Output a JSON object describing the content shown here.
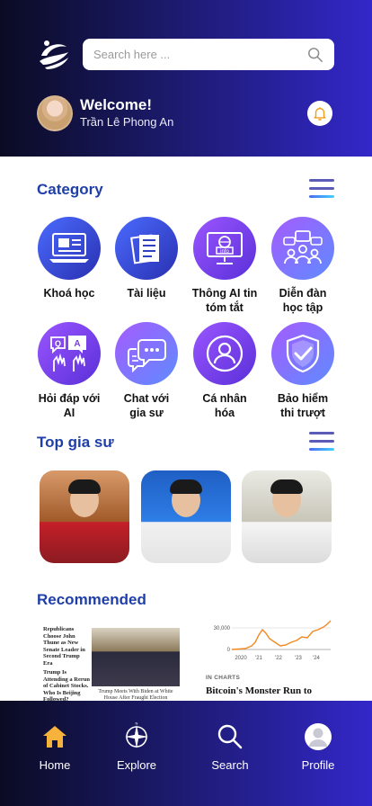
{
  "header": {
    "search_placeholder": "Search here ...",
    "welcome": "Welcome!",
    "user_name": "Trần Lê Phong An"
  },
  "category": {
    "title": "Category",
    "items": [
      {
        "label_line1": "Khoá học",
        "label_line2": "",
        "icon": "course-monitor-icon"
      },
      {
        "label_line1": "Tài liệu",
        "label_line2": "",
        "icon": "documents-icon"
      },
      {
        "label_line1": "Thông AI tin",
        "label_line2": "tóm tắt",
        "icon": "info-monitor-icon"
      },
      {
        "label_line1": "Diễn đàn",
        "label_line2": "học tập",
        "icon": "forum-group-icon"
      },
      {
        "label_line1": "Hỏi đáp với",
        "label_line2": "AI",
        "icon": "qa-bubbles-icon"
      },
      {
        "label_line1": "Chat với",
        "label_line2": "gia sư",
        "icon": "chat-icon"
      },
      {
        "label_line1": "Cá nhân",
        "label_line2": "hóa",
        "icon": "person-icon"
      },
      {
        "label_line1": "Bảo hiểm",
        "label_line2": "thi trượt",
        "icon": "shield-check-icon"
      }
    ]
  },
  "top_tutors": {
    "title": "Top gia sư"
  },
  "recommended": {
    "title": "Recommended",
    "card1": {
      "headline": "Republicans Choose John Thune as New Senate Leader in Second Trump Era",
      "headline2": "Trump Is Attending a Rerun of Cabinet Stocks. Who Is Beijing Followed?",
      "caption": "Trump Meets With Biden at White House After Fraught Election"
    },
    "card2": {
      "y_tick_top": "30,000",
      "y_tick_bottom": "0",
      "x_ticks": [
        "2020",
        "'21",
        "'22",
        "'23",
        "'24"
      ],
      "section": "IN CHARTS",
      "headline": "Bitcoin's Monster Run to"
    }
  },
  "nav": {
    "home": "Home",
    "explore": "Explore",
    "search": "Search",
    "profile": "Profile",
    "active_color": "#f6b23a"
  }
}
